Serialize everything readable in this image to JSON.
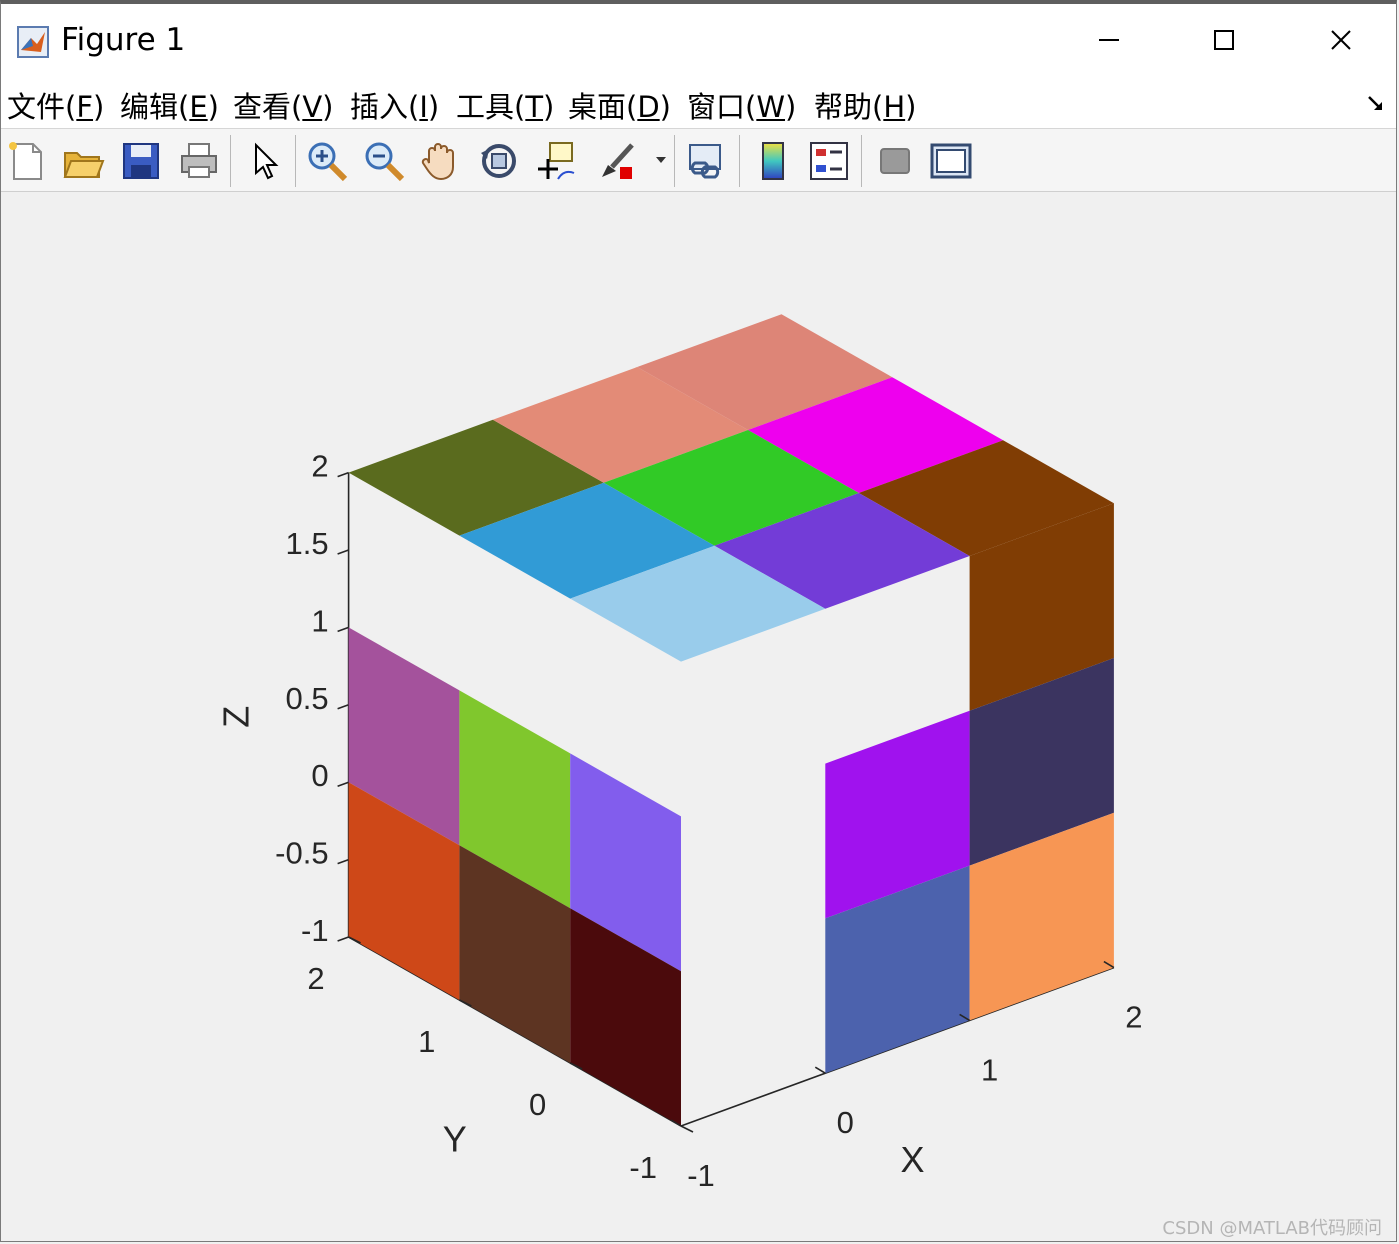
{
  "window": {
    "title": "Figure 1"
  },
  "menu": [
    {
      "label": "文件(",
      "key": "F",
      "tail": ")"
    },
    {
      "label": "编辑(",
      "key": "E",
      "tail": ")"
    },
    {
      "label": "查看(",
      "key": "V",
      "tail": ")"
    },
    {
      "label": "插入(",
      "key": "I",
      "tail": ")"
    },
    {
      "label": "工具(",
      "key": "T",
      "tail": ")"
    },
    {
      "label": "桌面(",
      "key": "D",
      "tail": ")"
    },
    {
      "label": "窗口(",
      "key": "W",
      "tail": ")"
    },
    {
      "label": "帮助(",
      "key": "H",
      "tail": ")"
    }
  ],
  "toolbar": [
    "new-figure-icon",
    "open-file-icon",
    "save-icon",
    "print-icon",
    "select-pointer-icon",
    "zoom-in-icon",
    "zoom-out-icon",
    "pan-hand-icon",
    "rotate-3d-icon",
    "data-cursor-icon",
    "brush-icon",
    "link-plot-icon",
    "colorbar-icon",
    "legend-icon",
    "hide-plot-tools-icon",
    "show-plot-tools-icon"
  ],
  "chart_data": {
    "type": "3d-voxel-cube",
    "xlabel": "X",
    "ylabel": "Y",
    "zlabel": "Z",
    "xlim": [
      -1,
      2
    ],
    "ylim": [
      -1,
      2
    ],
    "zlim": [
      -1,
      2
    ],
    "xticks": [
      "-1",
      "0",
      "1",
      "2"
    ],
    "yticks": [
      "-1",
      "0",
      "1",
      "2"
    ],
    "zticks": [
      "-1",
      "-0.5",
      "0",
      "0.5",
      "1",
      "1.5",
      "2"
    ],
    "cells": [
      {
        "face": "top",
        "x": 0,
        "y": 2,
        "color": "#5a6b1e"
      },
      {
        "face": "top",
        "x": 1,
        "y": 2,
        "color": "#e38b77"
      },
      {
        "face": "top",
        "x": 2,
        "y": 2,
        "color": "#dd8577"
      },
      {
        "face": "top",
        "x": 2,
        "y": 1,
        "color": "#ee00ee"
      },
      {
        "face": "top",
        "x": 2,
        "y": 0,
        "color": "#803d04"
      },
      {
        "face": "top",
        "x": 1,
        "y": 1,
        "color": "#31ca26"
      },
      {
        "face": "top",
        "x": 0,
        "y": 1,
        "color": "#319bd6"
      },
      {
        "face": "top",
        "x": 1,
        "y": 0,
        "color": "#733cd7"
      },
      {
        "face": "top",
        "x": 0,
        "y": 0,
        "color": "#99cceb"
      },
      {
        "face": "side-y",
        "y": 2,
        "z": 1,
        "color": "#a4529c"
      },
      {
        "face": "side-y",
        "y": 2,
        "z": 0,
        "color": "#ce4818"
      },
      {
        "face": "side-y",
        "y": 1,
        "z": 1,
        "color": "#80c72d"
      },
      {
        "face": "side-y",
        "y": 1,
        "z": 0,
        "color": "#5d3422"
      },
      {
        "face": "side-y",
        "y": 0,
        "z": 1,
        "color": "#825ded"
      },
      {
        "face": "side-y",
        "y": 0,
        "z": 0,
        "color": "#4b0a0c"
      },
      {
        "face": "side-x",
        "x": 1,
        "z": 1,
        "color": "#a012ee"
      },
      {
        "face": "side-x",
        "x": 1,
        "z": 0,
        "color": "#4c62ad"
      },
      {
        "face": "side-x",
        "x": 2,
        "z": 2,
        "color": "#803d04"
      },
      {
        "face": "side-x",
        "x": 2,
        "z": 1,
        "color": "#3b3460"
      },
      {
        "face": "side-x",
        "x": 2,
        "z": 0,
        "color": "#f79654"
      }
    ]
  },
  "watermark": "CSDN @MATLAB代码顾问"
}
